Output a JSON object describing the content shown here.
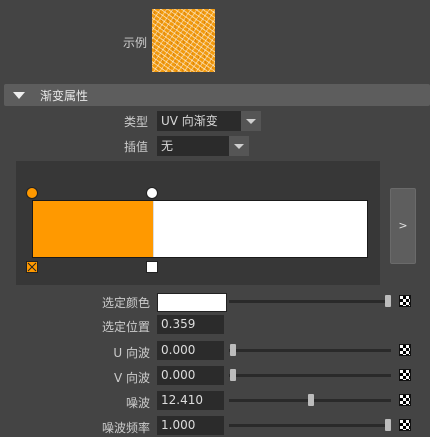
{
  "sample": {
    "label": "示例"
  },
  "section": {
    "title": "渐变属性"
  },
  "type_row": {
    "label": "类型",
    "value": "UV 向渐变"
  },
  "interp_row": {
    "label": "插值",
    "value": "无"
  },
  "ramp": {
    "left_color": "#ff9900",
    "right_color": "#ffffff",
    "split_fraction": 0.359,
    "expand_label": ">"
  },
  "selected_color": {
    "label": "选定颜色",
    "value": "#ffffff",
    "slider_fraction": 1.0
  },
  "selected_position": {
    "label": "选定位置",
    "value": "0.359"
  },
  "u_wave": {
    "label": "U 向波",
    "value": "0.000",
    "slider_fraction": 0.0
  },
  "v_wave": {
    "label": "V 向波",
    "value": "0.000",
    "slider_fraction": 0.0
  },
  "noise": {
    "label": "噪波",
    "value": "12.410",
    "slider_fraction": 0.5
  },
  "noise_freq": {
    "label": "噪波频率",
    "value": "1.000",
    "slider_fraction": 1.0
  },
  "icons": {
    "collapse": "triangle-down-icon",
    "texture": "checker-map-icon"
  }
}
